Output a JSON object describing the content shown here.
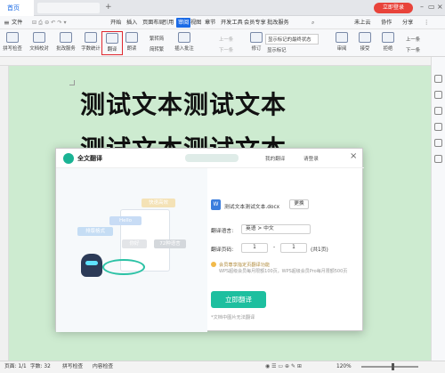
{
  "tabs": {
    "home": "首页"
  },
  "account": {
    "login": "立即登录"
  },
  "menu": {
    "file": "文件",
    "items": [
      "开始",
      "插入",
      "页面布局",
      "引用",
      "审阅",
      "视图",
      "章节",
      "开发工具",
      "会员专享",
      "批改服务"
    ],
    "active_index": 4,
    "right": [
      "未上云",
      "协作",
      "分享"
    ]
  },
  "ribbon": {
    "buttons": [
      "拼写检查",
      "文档校对",
      "批改服务",
      "字数统计",
      "翻译",
      "朗读"
    ],
    "small": [
      "繁转简",
      "简转繁",
      "插入批注"
    ],
    "track": [
      "修订",
      "显示标记的最终状态",
      "显示标记",
      "审阅",
      "接受",
      "拒绝"
    ],
    "nav_prev": "上一条",
    "nav_next": "下一条"
  },
  "document": {
    "line1": "测试文本测试文本",
    "line2": "测试文本测试文本"
  },
  "dialog": {
    "title": "全文翻译",
    "my_translations": "我的翻译",
    "login": "请登录",
    "tags": [
      "快速高效",
      "Hello",
      "排版格式",
      "你好",
      "72种语言"
    ],
    "file_name": "测试文本测试文本.docx",
    "change": "更换",
    "language_label": "翻译语言:",
    "language_value": "英语 > 中文",
    "pages_label": "翻译页码:",
    "page_from": "1",
    "page_to": "1",
    "page_total": "(共1页)",
    "member_note": "会员尊享指定页翻译功能",
    "member_detail": "WPS超级会员每月限额100页，WPS超级会员Pro每月限额500页",
    "translate_button": "立即翻译",
    "footer_note": "*文档中图片无法翻译"
  },
  "status": {
    "page": "页面: 1/1",
    "words": "字数: 32",
    "spell": "拼写检查",
    "content_check": "内容检查",
    "zoom": "120%"
  },
  "colors": {
    "accent": "#1a6ae6",
    "translate": "#1dbf9f",
    "doc_bg": "#cdebd0",
    "login": "#e8433a"
  }
}
